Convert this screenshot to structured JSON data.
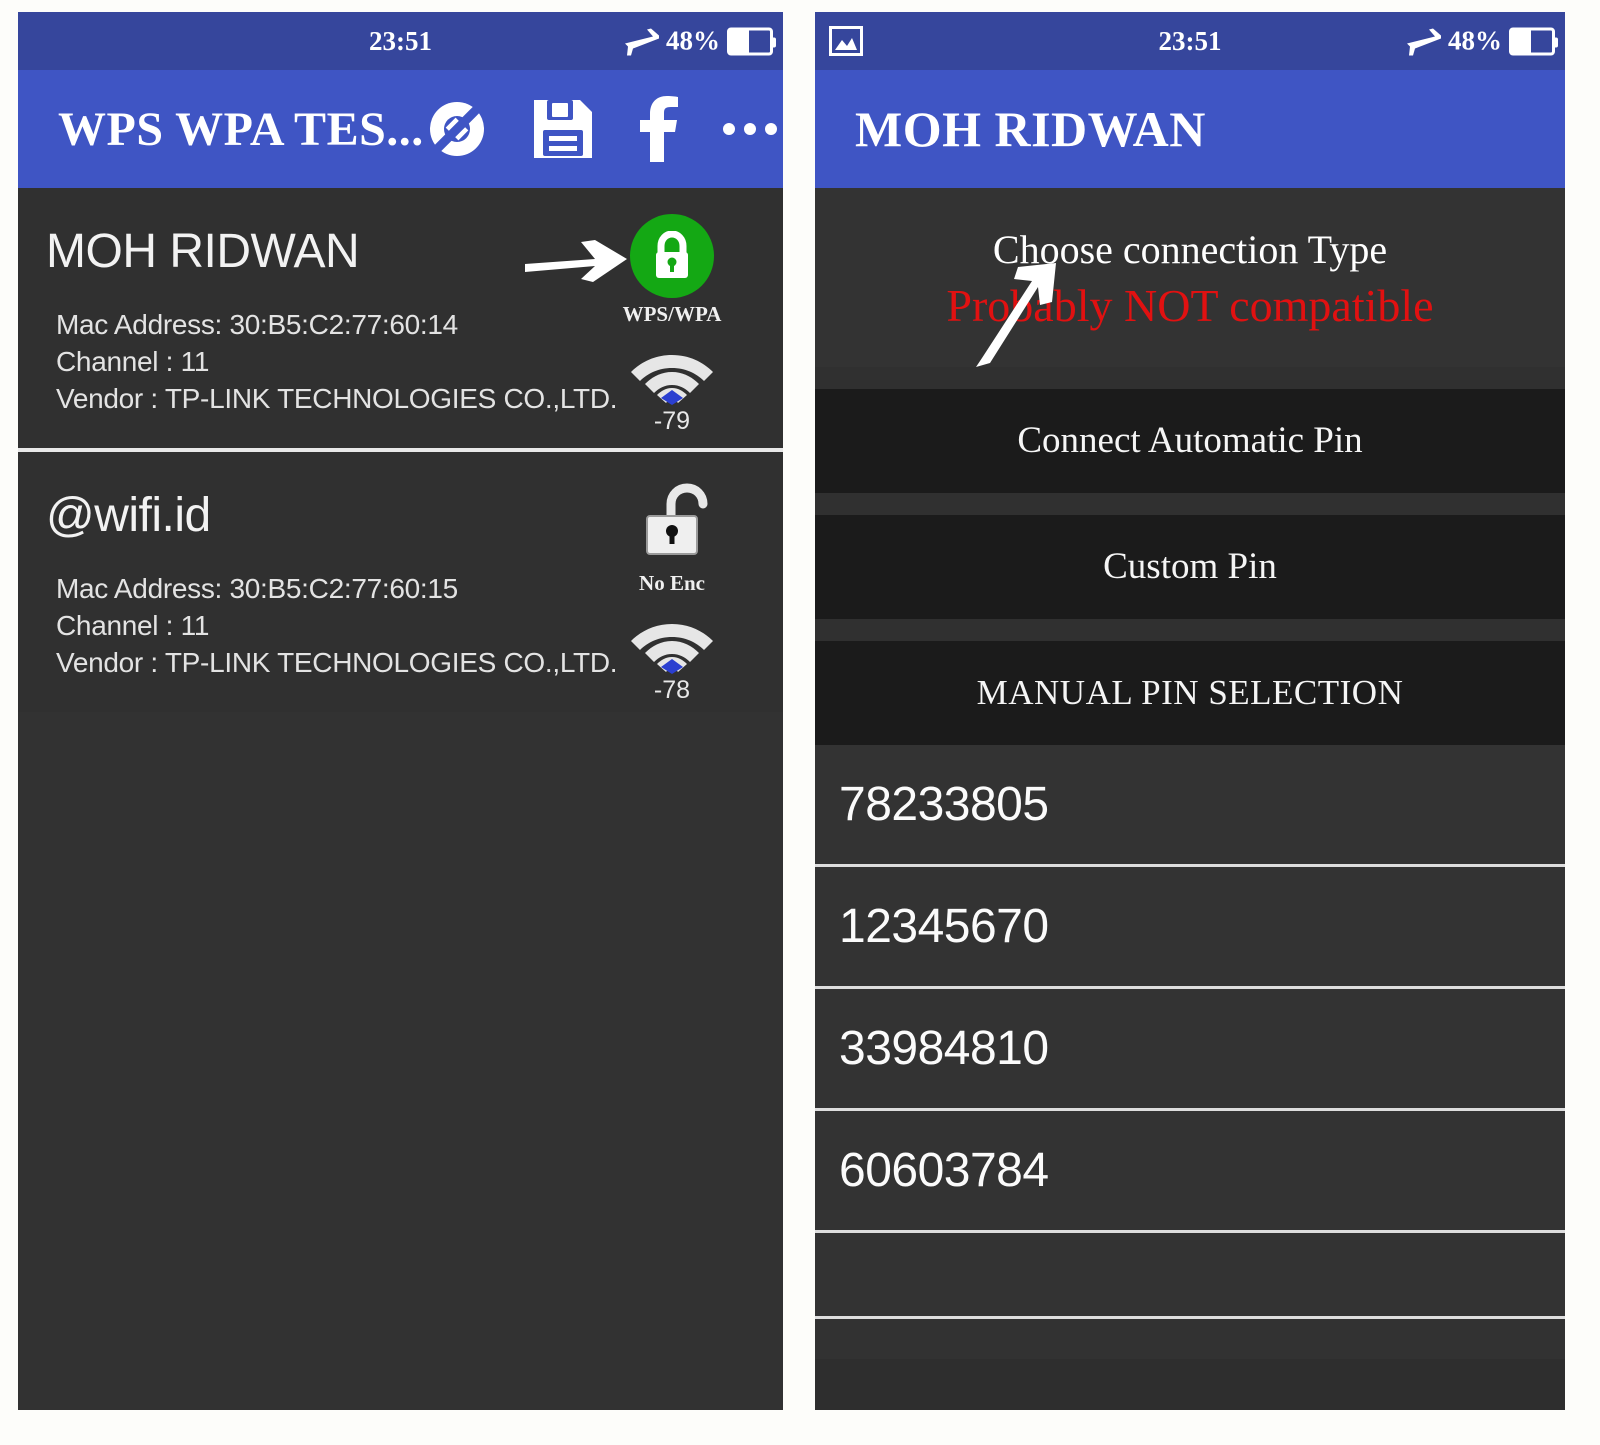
{
  "left_panel": {
    "statusbar": {
      "clock": "23:51",
      "battery_percent": "48%",
      "airplane_icon": "airplane-mode-icon",
      "battery_icon": "battery-icon"
    },
    "appbar": {
      "title": "WPS WPA TES...",
      "actions": [
        {
          "name": "scan-refresh-icon",
          "label": "Scan"
        },
        {
          "name": "save-icon",
          "label": "Save"
        },
        {
          "name": "facebook-icon",
          "label": "Facebook"
        },
        {
          "name": "overflow-menu-icon",
          "label": "More options"
        }
      ]
    },
    "networks": [
      {
        "ssid": "MOH RIDWAN",
        "mac_label": "Mac Address: 30:B5:C2:77:60:14",
        "channel_label": "Channel : 11",
        "vendor_label": "Vendor : TP-LINK TECHNOLOGIES CO.,LTD.",
        "security_label": "WPS/WPA",
        "security_state": "locked",
        "signal_dbm": "-79",
        "lock_color": "#14a814",
        "has_arrow_annotation": true
      },
      {
        "ssid": "@wifi.id",
        "mac_label": "Mac Address: 30:B5:C2:77:60:15",
        "channel_label": "Channel : 11",
        "vendor_label": "Vendor : TP-LINK TECHNOLOGIES CO.,LTD.",
        "security_label": "No Enc",
        "security_state": "unlocked",
        "signal_dbm": "-78",
        "has_arrow_annotation": false
      }
    ]
  },
  "right_panel": {
    "statusbar": {
      "clock": "23:51",
      "battery_percent": "48%",
      "screenshot_icon": "picture-icon",
      "airplane_icon": "airplane-mode-icon",
      "battery_icon": "battery-icon"
    },
    "appbar": {
      "title": "MOH RIDWAN"
    },
    "choose": {
      "title": "Choose connection Type",
      "warning": "Probably NOT compatible",
      "warning_color": "#e11111"
    },
    "menu_items": [
      {
        "label": "Connect Automatic Pin",
        "has_arrow_annotation": true
      },
      {
        "label": "Custom Pin",
        "has_arrow_annotation": false
      },
      {
        "label": "MANUAL PIN SELECTION",
        "has_arrow_annotation": false
      }
    ],
    "pins": [
      "78233805",
      "12345670",
      "33984810",
      "60603784"
    ]
  },
  "colors": {
    "statusbar": "#36469c",
    "appbar": "#3f55c4",
    "card_bg": "#303030",
    "menu_row_bg": "#1b1b1b",
    "accent_green": "#14a814",
    "accent_red": "#e11111",
    "signal_dot_blue": "#2b3fd0"
  }
}
